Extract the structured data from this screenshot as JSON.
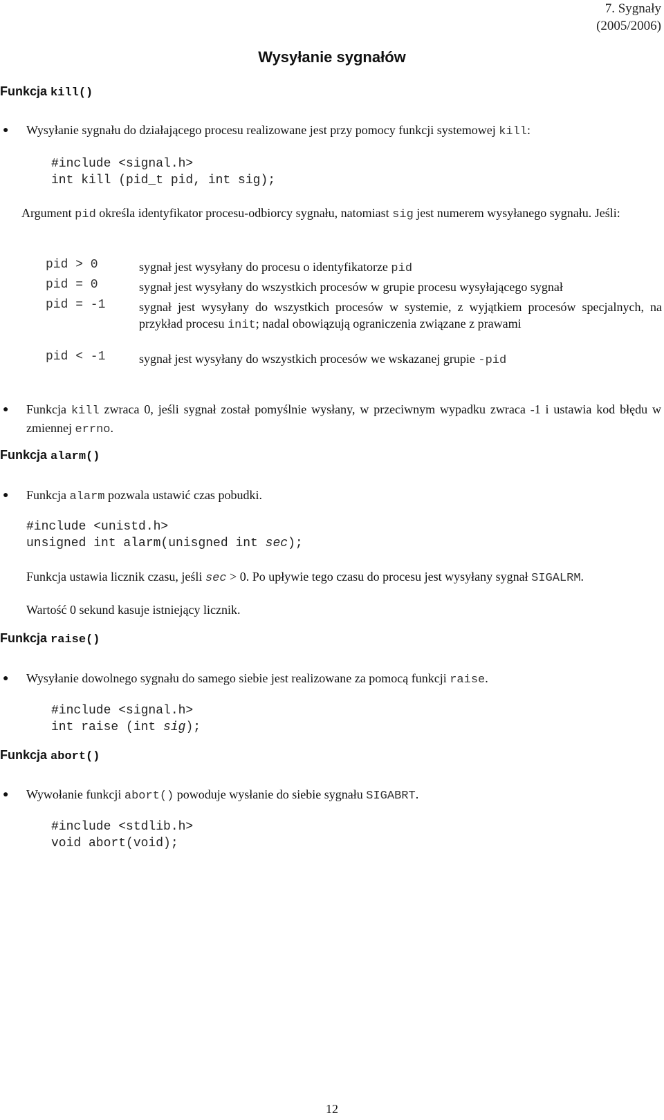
{
  "header": {
    "chapter": "7. Sygnały",
    "years": "(2005/2006)"
  },
  "title": "Wysyłanie sygnałów",
  "sections": {
    "kill": {
      "heading_prefix": "Funkcja",
      "heading_code": "kill()",
      "bullet1": {
        "text": "Wysyłanie sygnału do działającego procesu realizowane jest przy pomocy funkcji systemowej ",
        "code": "kill",
        "suffix": ":"
      },
      "code_lines": [
        "#include <signal.h>",
        "int kill (pid_t pid, int sig);"
      ],
      "argument": {
        "p1": "Argument ",
        "c1": "pid",
        "p2": " określa identyfikator procesu-odbiorcy sygnału, natomiast ",
        "c2": "sig",
        "p3": "  jest numerem wysyłanego sygnału. Jeśli:"
      },
      "cases": [
        {
          "key": "pid > 0",
          "desc": "sygnał jest wysyłany do procesu o identyfikatorze ",
          "code": "pid",
          "rest": ""
        },
        {
          "key": "pid = 0",
          "desc": "sygnał jest wysyłany do wszystkich procesów w grupie procesu wysyłającego sygnał",
          "code": "",
          "rest": ""
        },
        {
          "key": "pid = -1",
          "desc": "sygnał jest wysyłany do wszystkich procesów w systemie, z wyjątkiem procesów specjalnych, na przykład procesu ",
          "code": "init",
          "rest": "; nadal obowiązują ograniczenia związane z prawami"
        },
        {
          "key": "pid < -1",
          "desc": "sygnał jest wysyłany do wszystkich procesów we wskazanej grupie ",
          "code": "-pid",
          "rest": ""
        }
      ],
      "bullet2": {
        "p1": "Funkcja ",
        "c1": "kill",
        "p2": " zwraca 0, jeśli sygnał został pomyślnie wysłany, w przeciwnym wypadku zwraca -1 i ustawia kod błędu w zmiennej ",
        "c2": "errno",
        "p3": "."
      }
    },
    "alarm": {
      "heading_prefix": "Funkcja",
      "heading_code": "alarm()",
      "bullet": {
        "p1": "Funkcja ",
        "c1": "alarm",
        "p2": "  pozwala ustawić czas pobudki."
      },
      "code_line1": "#include <unistd.h>",
      "code_line2_a": "unsigned int alarm(unisgned int ",
      "code_line2_it": "sec",
      "code_line2_b": ");",
      "desc": {
        "p1": "Funkcja ustawia licznik czasu, jeśli ",
        "c1": "sec",
        "p2": " > 0. Po upływie tego czasu do procesu jest wysyłany sygnał ",
        "c2": "SIGALRM",
        "p3": "."
      },
      "note": "Wartość 0 sekund kasuje istniejący licznik."
    },
    "raise": {
      "heading_prefix": "Funkcja",
      "heading_code": "raise()",
      "bullet": {
        "p1": "Wysyłanie dowolnego sygnału do samego siebie jest realizowane za pomocą funkcji ",
        "c1": "raise",
        "p2": "."
      },
      "code_line1": "#include <signal.h>",
      "code_line2_a": "int raise (int ",
      "code_line2_it": "sig",
      "code_line2_b": ");"
    },
    "abort": {
      "heading_prefix": "Funkcja",
      "heading_code": "abort()",
      "bullet": {
        "p1": "Wywołanie funkcji ",
        "c1": "abort()",
        "p2": " powoduje wysłanie do siebie sygnału ",
        "c2": "SIGABRT",
        "p3": "."
      },
      "code_lines": [
        "#include <stdlib.h>",
        "void abort(void);"
      ]
    }
  },
  "page_number": "12"
}
